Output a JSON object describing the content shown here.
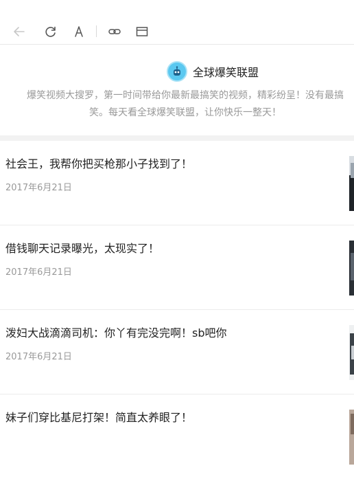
{
  "toolbar": {
    "buttons": [
      {
        "icon": "back-arrow-icon",
        "enabled": false
      },
      {
        "icon": "refresh-icon",
        "enabled": true
      },
      {
        "icon": "font-size-icon",
        "label": "A",
        "enabled": true
      },
      {
        "icon": "link-icon",
        "enabled": true
      },
      {
        "icon": "window-icon",
        "enabled": true
      }
    ]
  },
  "profile": {
    "avatar_icon": "robot-mascot-icon",
    "avatar_color": "#5bc8f0",
    "name": "全球爆笑联盟",
    "description_line1": "爆笑视频大搜罗，第一时间带给你最新最搞笑的视频，精彩纷呈！没有最搞",
    "description_line2": "笑。每天看全球爆笑联盟，让你快乐一整天！"
  },
  "feed": {
    "items": [
      {
        "title": "社会王，我帮你把买枪那小子找到了！",
        "date": "2017年6月21日"
      },
      {
        "title": "借钱聊天记录曝光，太现实了！",
        "date": "2017年6月21日"
      },
      {
        "title": "泼妇大战滴滴司机：你丫有完没完啊！sb吧你",
        "date": "2017年6月21日"
      },
      {
        "title": "妹子们穿比基尼打架！简直太养眼了！",
        "date": ""
      }
    ]
  }
}
